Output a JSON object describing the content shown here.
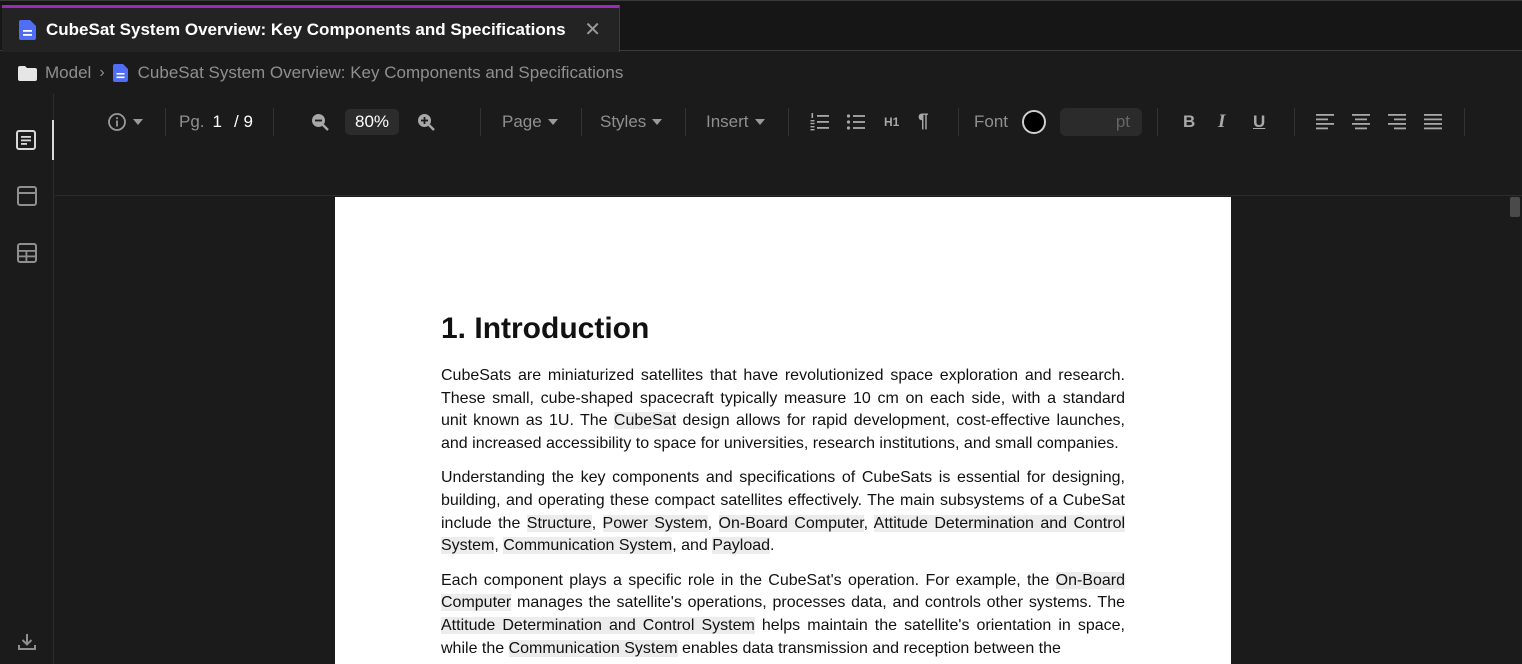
{
  "tab": {
    "title": "CubeSat System Overview: Key Components and Specifications",
    "close": "✕"
  },
  "breadcrumb": {
    "root": "Model",
    "sep": "›",
    "doc": "CubeSat System Overview: Key Components and Specifications"
  },
  "toolbar": {
    "pg_label": "Pg.",
    "pg_current": "1",
    "pg_total": "/ 9",
    "zoom": "80%",
    "page_menu": "Page",
    "styles_menu": "Styles",
    "insert_menu": "Insert",
    "h1": "H1",
    "pilcrow": "¶",
    "font_label": "Font",
    "font_color": "#000000",
    "pt_suffix": "pt",
    "bold": "B",
    "italic": "I",
    "underline": "U"
  },
  "document": {
    "heading": "1. Introduction",
    "p1": "CubeSats are miniaturized satellites that have revolutionized space exploration and research. These small, cube-shaped spacecraft typically measure 10 cm on each side, with a standard unit known as 1U. The ",
    "p1_hl": "CubeSat",
    "p1_b": " design allows for rapid development, cost-effective launches, and increased accessibility to space for universities, research institutions, and small companies.",
    "p2_a": "Understanding the key components and specifications of CubeSats is essential for designing, building, and operating these compact satellites effectively. The main subsystems of a CubeSat include the ",
    "p2_structure": "Structure",
    "p2_c1": ", ",
    "p2_power": "Power System",
    "p2_c2": ", ",
    "p2_obc": "On-Board Computer",
    "p2_c3": ", ",
    "p2_adcs": "Attitude Determination and Control System",
    "p2_c4": ", ",
    "p2_comm": "Communication System",
    "p2_c5": ", and ",
    "p2_payload": "Payload",
    "p2_end": ".",
    "p3_a": "Each component plays a specific role in the CubeSat's operation. For example, the ",
    "p3_obc": "On-Board Computer",
    "p3_b": " manages the satellite's operations, processes data, and controls other systems. The ",
    "p3_adcs": "Attitude Determination and Control System",
    "p3_c": " helps maintain the satellite's orientation in space, while the ",
    "p3_comm": "Communication System",
    "p3_d": " enables data transmission and reception between the"
  },
  "colors": {
    "tab_accent": "#9b2bb8",
    "doc_icon": "#4f6df5"
  },
  "icons": [
    "document-icon",
    "folder-icon",
    "info-icon",
    "zoom-out-icon",
    "zoom-in-icon",
    "ordered-list-icon",
    "bullet-list-icon",
    "align-left-icon",
    "align-center-icon",
    "align-right-icon",
    "align-justify-icon",
    "outline-icon",
    "panel-icon",
    "table-icon",
    "download-icon"
  ]
}
